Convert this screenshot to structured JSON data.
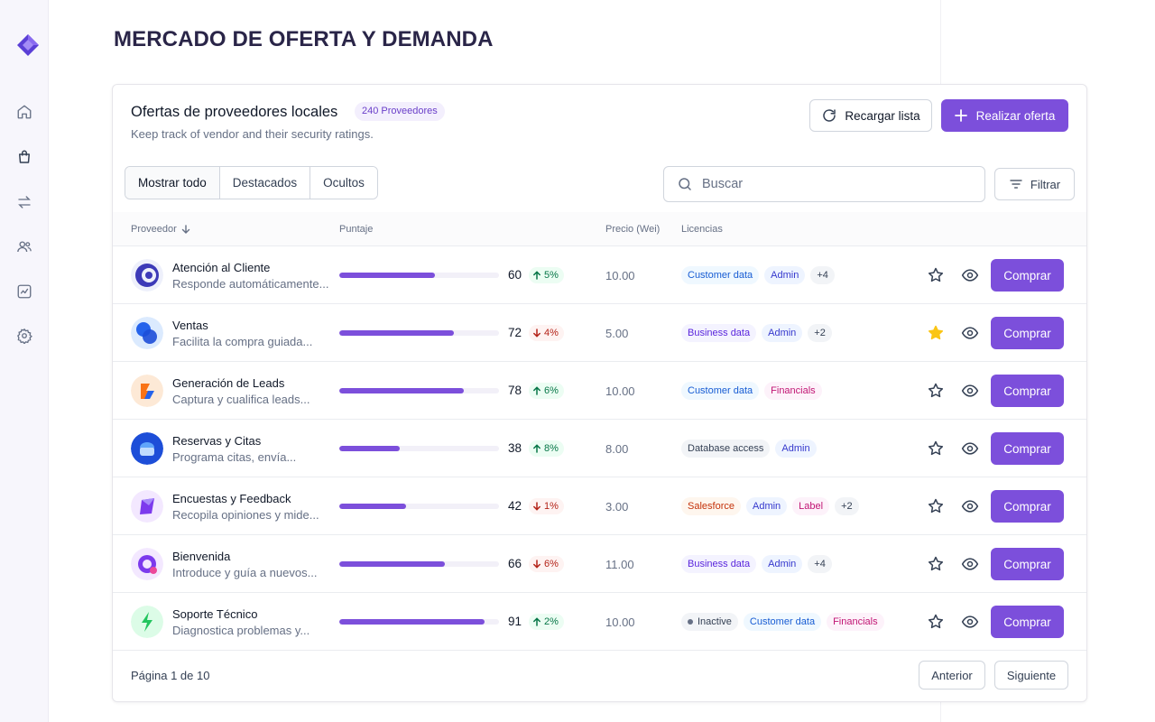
{
  "page": {
    "title": "MERCADO DE OFERTA Y DEMANDA"
  },
  "sidebar": {
    "items": [
      {
        "icon": "home-icon"
      },
      {
        "icon": "shopping-bag-icon"
      },
      {
        "icon": "transfer-arrows-icon"
      },
      {
        "icon": "users-icon"
      },
      {
        "icon": "chart-icon"
      },
      {
        "icon": "gear-icon"
      }
    ]
  },
  "card": {
    "title": "Ofertas de proveedores locales",
    "badge": "240 Proveedores",
    "subtitle": "Keep track of vendor and their security ratings.",
    "reload_label": "Recargar lista",
    "offer_label": "Realizar oferta"
  },
  "tabs": [
    {
      "label": "Mostrar todo",
      "active": true
    },
    {
      "label": "Destacados",
      "active": false
    },
    {
      "label": "Ocultos",
      "active": false
    }
  ],
  "search": {
    "placeholder": "Buscar",
    "value": ""
  },
  "filter_label": "Filtrar",
  "columns": {
    "vendor": "Proveedor",
    "score": "Puntaje",
    "price": "Precio (Wei)",
    "licenses": "Licencias"
  },
  "rows": [
    {
      "name": "Atención al Cliente",
      "desc": "Responde automáticamente...",
      "score": 60,
      "delta": "5%",
      "trend": "up",
      "price": "10.00",
      "tags": [
        {
          "text": "Customer data",
          "style": "blue"
        },
        {
          "text": "Admin",
          "style": "indigo"
        },
        {
          "text": "+4",
          "style": "gray"
        }
      ],
      "starred": false
    },
    {
      "name": "Ventas",
      "desc": "Facilita la compra guiada...",
      "score": 72,
      "delta": "4%",
      "trend": "down",
      "price": "5.00",
      "tags": [
        {
          "text": "Business data",
          "style": "purple"
        },
        {
          "text": "Admin",
          "style": "indigo"
        },
        {
          "text": "+2",
          "style": "gray"
        }
      ],
      "starred": true
    },
    {
      "name": "Generación de Leads",
      "desc": "Captura y cualifica leads...",
      "score": 78,
      "delta": "6%",
      "trend": "up",
      "price": "10.00",
      "tags": [
        {
          "text": "Customer data",
          "style": "blue"
        },
        {
          "text": "Financials",
          "style": "pink"
        }
      ],
      "starred": false
    },
    {
      "name": "Reservas y Citas",
      "desc": "Programa citas, envía...",
      "score": 38,
      "delta": "8%",
      "trend": "up",
      "price": "8.00",
      "tags": [
        {
          "text": "Database access",
          "style": "gray"
        },
        {
          "text": "Admin",
          "style": "indigo"
        }
      ],
      "starred": false
    },
    {
      "name": "Encuestas y Feedback",
      "desc": "Recopila opiniones y mide...",
      "score": 42,
      "delta": "1%",
      "trend": "down",
      "price": "3.00",
      "tags": [
        {
          "text": "Salesforce",
          "style": "orange"
        },
        {
          "text": "Admin",
          "style": "indigo"
        },
        {
          "text": "Label",
          "style": "pink"
        },
        {
          "text": "+2",
          "style": "gray"
        }
      ],
      "starred": false
    },
    {
      "name": "Bienvenida",
      "desc": "Introduce y guía a nuevos...",
      "score": 66,
      "delta": "6%",
      "trend": "down",
      "price": "11.00",
      "tags": [
        {
          "text": "Business data",
          "style": "purple"
        },
        {
          "text": "Admin",
          "style": "indigo"
        },
        {
          "text": "+4",
          "style": "gray"
        }
      ],
      "starred": false
    },
    {
      "name": "Soporte Técnico",
      "desc": "Diagnostica problemas y...",
      "score": 91,
      "delta": "2%",
      "trend": "up",
      "price": "10.00",
      "tags": [
        {
          "text": "Inactive",
          "style": "gray",
          "dot": true
        },
        {
          "text": "Customer data",
          "style": "blue"
        },
        {
          "text": "Financials",
          "style": "pink"
        }
      ],
      "starred": false
    }
  ],
  "buy_label": "Comprar",
  "pagination": {
    "text": "Página 1 de 10",
    "prev": "Anterior",
    "next": "Siguiente"
  },
  "colors": {
    "accent": "#7c4fdb",
    "star_active": "#fac515"
  }
}
